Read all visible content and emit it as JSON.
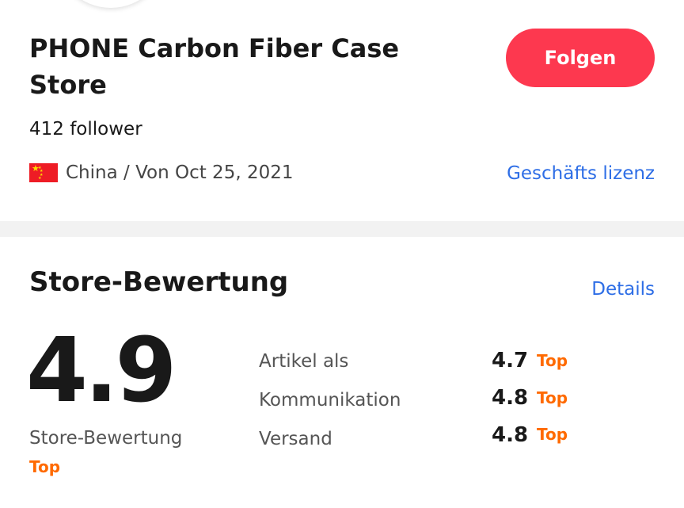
{
  "store": {
    "name": "PHONE Carbon Fiber Case Store",
    "follow_label": "Folgen",
    "followers": "412 follower",
    "country_icon": "china-flag-icon",
    "origin": "China / Von Oct 25, 2021",
    "license_link": "Geschäfts lizenz"
  },
  "colors": {
    "accent": "#fd384f",
    "link": "#2e6ee6",
    "badge": "#ff6a00"
  },
  "rating": {
    "title": "Store-Bewertung",
    "details_link": "Details",
    "overall": {
      "score": "4.9",
      "label": "Store-Bewertung",
      "badge": "Top"
    },
    "metrics": [
      {
        "label": "Artikel als",
        "value": "4.7",
        "badge": "Top"
      },
      {
        "label": "Kommunikation",
        "value": "4.8",
        "badge": "Top"
      },
      {
        "label": "Versand",
        "value": "4.8",
        "badge": "Top"
      }
    ]
  }
}
